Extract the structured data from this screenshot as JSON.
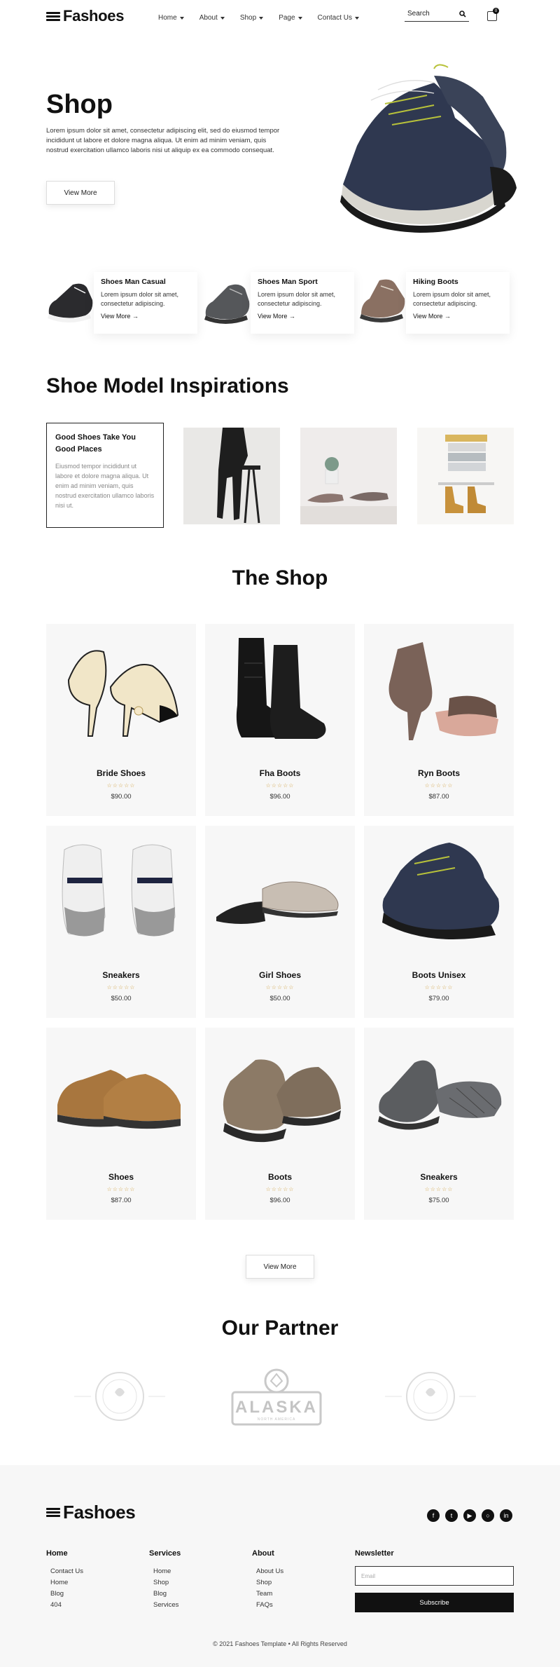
{
  "brand": "Fashoes",
  "nav": [
    {
      "label": "Home"
    },
    {
      "label": "About"
    },
    {
      "label": "Shop"
    },
    {
      "label": "Page"
    },
    {
      "label": "Contact Us"
    }
  ],
  "search": {
    "placeholder": "Search"
  },
  "cart": {
    "count": "0"
  },
  "hero": {
    "title": "Shop",
    "text": "Lorem ipsum dolor sit amet, consectetur adipiscing elit, sed do eiusmod tempor incididunt ut labore et dolore magna aliqua. Ut enim ad minim veniam, quis nostrud exercitation ullamco laboris nisi ut aliquip ex ea commodo consequat.",
    "button": "View More"
  },
  "categories": [
    {
      "title": "Shoes Man Casual",
      "desc": "Lorem ipsum dolor sit amet, consectetur adipiscing.",
      "link": "View More →"
    },
    {
      "title": "Shoes Man Sport",
      "desc": "Lorem ipsum dolor sit amet, consectetur adipiscing.",
      "link": "View More →"
    },
    {
      "title": "Hiking Boots",
      "desc": "Lorem ipsum dolor sit amet, consectetur adipiscing.",
      "link": "View More →"
    }
  ],
  "inspirations": {
    "heading": "Shoe Model Inspirations",
    "card_title": "Good Shoes Take You Good Places",
    "card_text": "Eiusmod tempor incididunt ut labore et dolore magna aliqua. Ut enim ad minim veniam, quis nostrud exercitation ullamco laboris nisi ut."
  },
  "shop": {
    "heading": "The Shop",
    "stars": "☆☆☆☆☆",
    "products": [
      {
        "name": "Bride Shoes",
        "price": "$90.00"
      },
      {
        "name": "Fha Boots",
        "price": "$96.00"
      },
      {
        "name": "Ryn Boots",
        "price": "$87.00"
      },
      {
        "name": "Sneakers",
        "price": "$50.00"
      },
      {
        "name": "Girl Shoes",
        "price": "$50.00"
      },
      {
        "name": "Boots Unisex",
        "price": "$79.00"
      },
      {
        "name": "Shoes",
        "price": "$87.00"
      },
      {
        "name": "Boots",
        "price": "$96.00"
      },
      {
        "name": "Sneakers",
        "price": "$75.00"
      }
    ],
    "button": "View More"
  },
  "partner": {
    "heading": "Our Partner",
    "alaska": "ALASKA",
    "alaska_sub": "NORTH AMERICA"
  },
  "footer": {
    "brand": "Fashoes",
    "cols": [
      {
        "title": "Home",
        "links": [
          "Contact Us",
          "Home",
          "Blog",
          "404"
        ]
      },
      {
        "title": "Services",
        "links": [
          "Home",
          "Shop",
          "Blog",
          "Services"
        ]
      },
      {
        "title": "About",
        "links": [
          "About Us",
          "Shop",
          "Team",
          "FAQs"
        ]
      }
    ],
    "newsletter": {
      "title": "Newsletter",
      "placeholder": "Email",
      "button": "Subscribe"
    },
    "copyright": "© 2021 Fashoes Template • All Rights Reserved"
  },
  "colors": {
    "accent": "#111111",
    "star": "#d0a040",
    "card_bg": "#f7f7f7"
  }
}
